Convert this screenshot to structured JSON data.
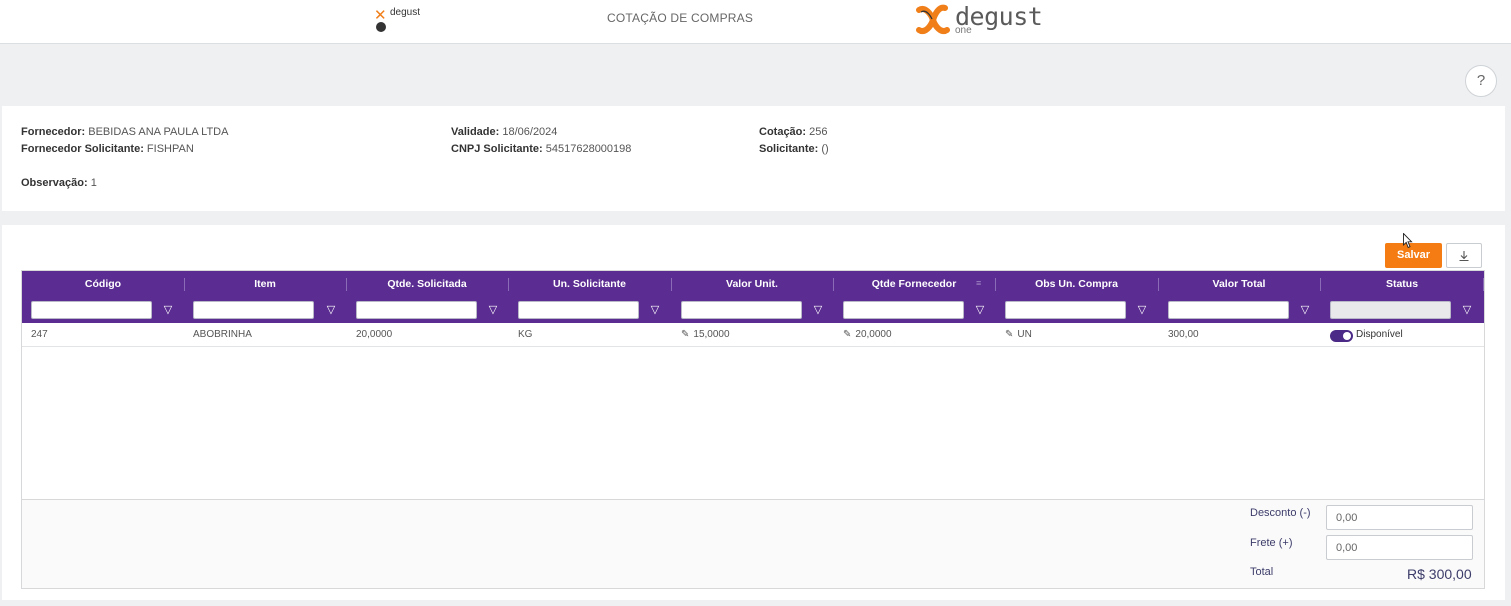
{
  "header": {
    "small_logo_name": "degust",
    "page_title": "COTAÇÃO DE COMPRAS",
    "brand_name": "degust",
    "brand_sub": "one"
  },
  "help": {
    "label": "?"
  },
  "info": {
    "fornecedor_label": "Fornecedor:",
    "fornecedor_value": "BEBIDAS ANA PAULA LTDA",
    "fornecedor_solicitante_label": "Fornecedor Solicitante:",
    "fornecedor_solicitante_value": "FISHPAN",
    "observacao_label": "Observação:",
    "observacao_value": "1",
    "validade_label": "Validade:",
    "validade_value": "18/06/2024",
    "cnpj_label": "CNPJ Solicitante:",
    "cnpj_value": "54517628000198",
    "cotacao_label": "Cotação:",
    "cotacao_value": "256",
    "solicitante_label": "Solicitante:",
    "solicitante_value": "()"
  },
  "toolbar": {
    "save_label": "Salvar",
    "export_icon": "download-icon"
  },
  "grid": {
    "columns": [
      "Código",
      "Item",
      "Qtde. Solicitada",
      "Un. Solicitante",
      "Valor Unit.",
      "Qtde Fornecedor",
      "Obs Un. Compra",
      "Valor Total",
      "Status"
    ],
    "rows": [
      {
        "codigo": "247",
        "item": "ABOBRINHA",
        "qtde_solicitada": "20,0000",
        "un_solicitante": "KG",
        "valor_unit": "15,0000",
        "qtde_fornecedor": "20,0000",
        "obs_un_compra": "UN",
        "valor_total": "300,00",
        "status": "Disponível",
        "status_on": true
      }
    ]
  },
  "footer": {
    "desconto_label": "Desconto (-)",
    "desconto_value": "0,00",
    "frete_label": "Frete (+)",
    "frete_value": "0,00",
    "total_label": "Total",
    "total_value": "R$ 300,00"
  },
  "colors": {
    "header_purple": "#5b2c91",
    "save_orange": "#f47c12",
    "toggle_on": "#4a2a86"
  }
}
